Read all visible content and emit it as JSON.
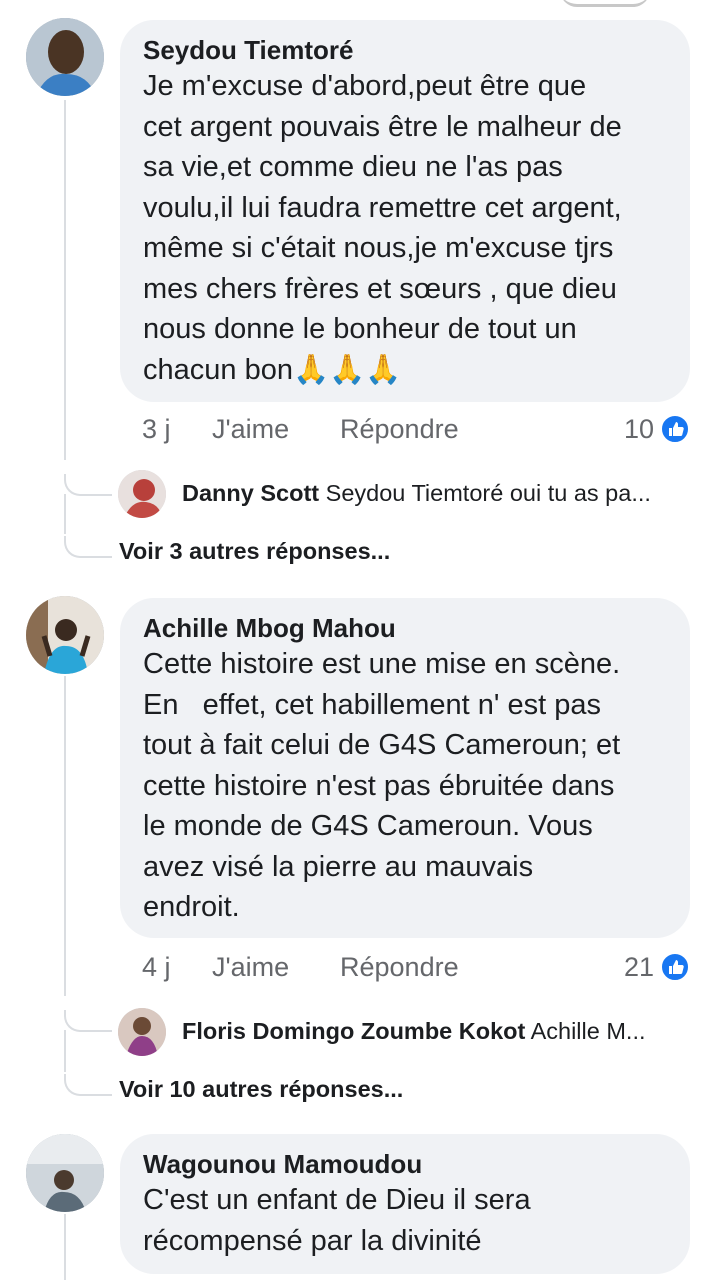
{
  "comments": [
    {
      "author": "Seydou Tiemtoré",
      "text": "Je m'excuse d'abord,peut être que\ncet argent pouvais être le malheur de\nsa vie,et comme dieu ne l'as pas\nvoulu,il lui faudra remettre cet argent,\nmême si c'était nous,je m'excuse tjrs\nmes chers frères et sœurs , que dieu\nnous donne le bonheur de tout un\nchacun bon",
      "emoji": "🙏🙏🙏",
      "time": "3 j",
      "like_label": "J'aime",
      "reply_label": "Répondre",
      "like_count": "10",
      "reply_preview": {
        "author": "Danny Scott",
        "text": "Seydou Tiemtoré oui tu as pa..."
      },
      "more_replies": "Voir 3 autres réponses..."
    },
    {
      "author": "Achille Mbog Mahou",
      "text": "Cette histoire est une mise en scène.\nEn   effet, cet habillement n' est pas\ntout à fait celui de G4S Cameroun; et\ncette histoire n'est pas ébruitée dans\nle monde de G4S Cameroun. Vous\navez visé la pierre au mauvais\nendroit.",
      "time": "4 j",
      "like_label": "J'aime",
      "reply_label": "Répondre",
      "like_count": "21",
      "reply_preview": {
        "author": "Floris Domingo Zoumbe Kokot",
        "text": "Achille M..."
      },
      "more_replies": "Voir 10 autres réponses..."
    },
    {
      "author": "Wagounou Mamoudou",
      "text": "C'est un enfant de Dieu il sera\nrécompensé par la divinité"
    }
  ],
  "colors": {
    "like_blue": "#1877f2",
    "bubble": "#f0f2f5",
    "meta_gray": "#65676b"
  }
}
